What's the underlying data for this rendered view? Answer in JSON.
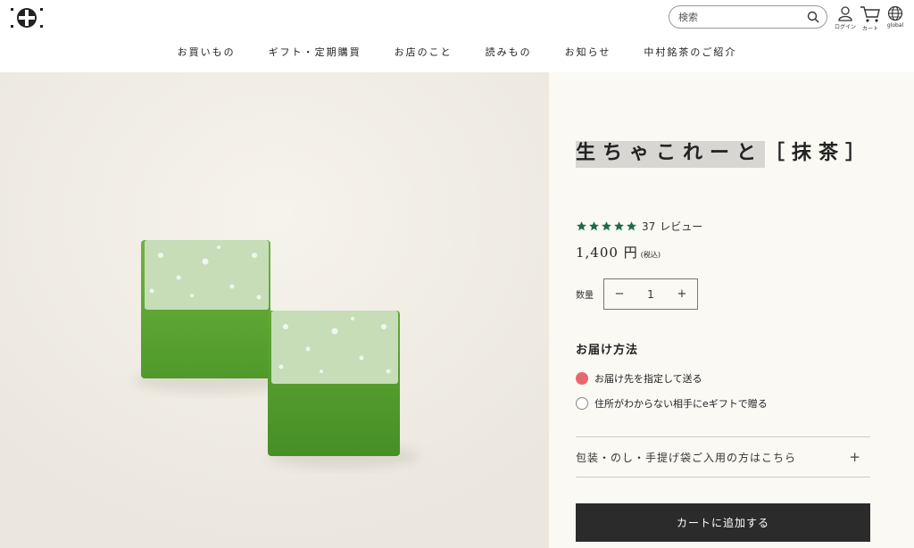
{
  "header": {
    "search": {
      "placeholder": "検索"
    },
    "icons": [
      {
        "name": "user-icon",
        "caption": "ログイン"
      },
      {
        "name": "cart-icon",
        "caption": "カート"
      },
      {
        "name": "globe-icon",
        "caption": "global"
      }
    ],
    "nav": [
      "お買いもの",
      "ギフト・定期購買",
      "お店のこと",
      "読みもの",
      "お知らせ",
      "中村銘茶のご紹介"
    ]
  },
  "product": {
    "title_highlight": "生ちゃこれーと",
    "title_rest": "［抹茶］",
    "rating": {
      "stars": 5,
      "review_count": "37",
      "review_label": "レビュー",
      "star_color": "#1f6b4a"
    },
    "price": "1,400 円",
    "price_note": "(税込)",
    "quantity_label": "数量",
    "quantity_minus": "−",
    "quantity": "1",
    "quantity_plus": "+",
    "delivery_title": "お届け方法",
    "delivery_options": [
      {
        "label": "お届け先を指定して送る",
        "selected": true
      },
      {
        "label": "住所がわからない相手にeギフトで贈る",
        "selected": false
      }
    ],
    "wrapping_label": "包装・のし・手提げ袋ご入用の方はこちら",
    "wrapping_expand": "+",
    "add_to_cart": "カートに追加する",
    "accent_color": "#e6676e",
    "button_color": "#2b2b2b"
  }
}
